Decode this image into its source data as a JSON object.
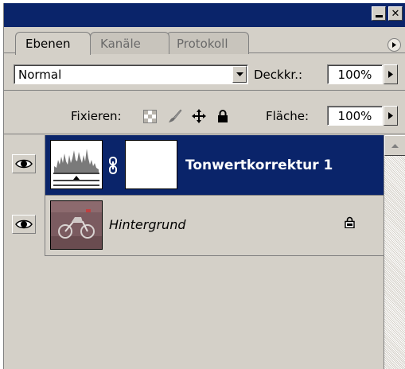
{
  "titlebar": {
    "minimize_label": "",
    "close_label": "✕"
  },
  "tabs": [
    {
      "label": "Ebenen",
      "active": true
    },
    {
      "label": "Kanäle",
      "active": false
    },
    {
      "label": "Protokoll",
      "active": false
    }
  ],
  "blend": {
    "mode": "Normal",
    "opacity_label": "Deckkr.:",
    "opacity_value": "100%"
  },
  "lock": {
    "label": "Fixieren:",
    "fill_label": "Fläche:",
    "fill_value": "100%",
    "icons": [
      "lock-transparency-icon",
      "lock-brush-icon",
      "lock-move-icon",
      "lock-all-icon"
    ]
  },
  "layers": [
    {
      "name": "Tonwertkorrektur 1",
      "selected": true,
      "visible": true,
      "type": "adjustment"
    },
    {
      "name": "Hintergrund",
      "selected": false,
      "visible": true,
      "type": "image",
      "locked": true
    }
  ],
  "colors": {
    "selection": "#0a246a",
    "panel": "#d4d0c8"
  }
}
